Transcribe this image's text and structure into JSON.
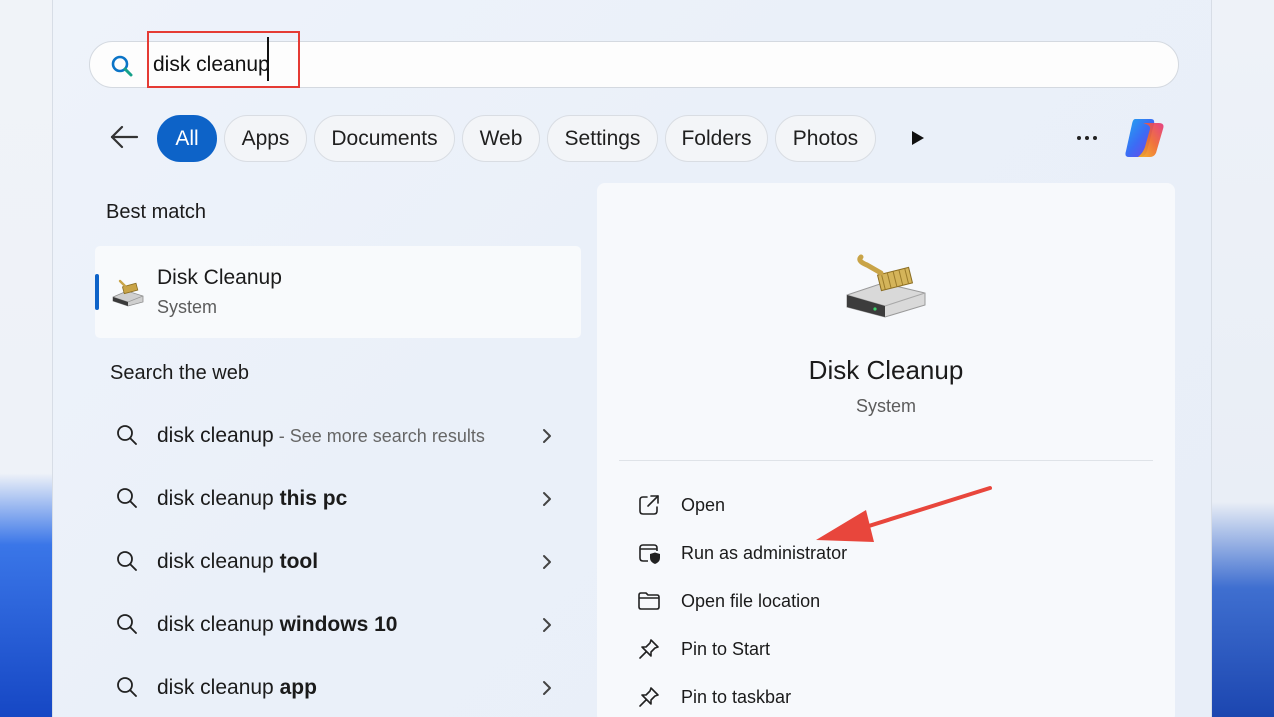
{
  "search": {
    "query": "disk cleanup"
  },
  "filters": [
    {
      "label": "All",
      "active": true
    },
    {
      "label": "Apps",
      "active": false
    },
    {
      "label": "Documents",
      "active": false
    },
    {
      "label": "Web",
      "active": false
    },
    {
      "label": "Settings",
      "active": false
    },
    {
      "label": "Folders",
      "active": false
    },
    {
      "label": "Photos",
      "active": false
    }
  ],
  "best_match": {
    "heading": "Best match",
    "name": "Disk Cleanup",
    "type": "System"
  },
  "web": {
    "heading": "Search the web",
    "items": [
      {
        "base": "disk cleanup",
        "bold": "",
        "suffix": " - See more search results"
      },
      {
        "base": "disk cleanup",
        "bold": " this pc",
        "suffix": ""
      },
      {
        "base": "disk cleanup",
        "bold": " tool",
        "suffix": ""
      },
      {
        "base": "disk cleanup",
        "bold": " windows 10",
        "suffix": ""
      },
      {
        "base": "disk cleanup",
        "bold": " app",
        "suffix": ""
      }
    ]
  },
  "preview": {
    "name": "Disk Cleanup",
    "type": "System",
    "actions": [
      {
        "label": "Open",
        "icon": "open-external-icon"
      },
      {
        "label": "Run as administrator",
        "icon": "shield-window-icon"
      },
      {
        "label": "Open file location",
        "icon": "folder-icon"
      },
      {
        "label": "Pin to Start",
        "icon": "pin-icon"
      },
      {
        "label": "Pin to taskbar",
        "icon": "pin-icon"
      }
    ]
  },
  "colors": {
    "accent": "#0d63c8",
    "highlight": "#e53b34"
  }
}
